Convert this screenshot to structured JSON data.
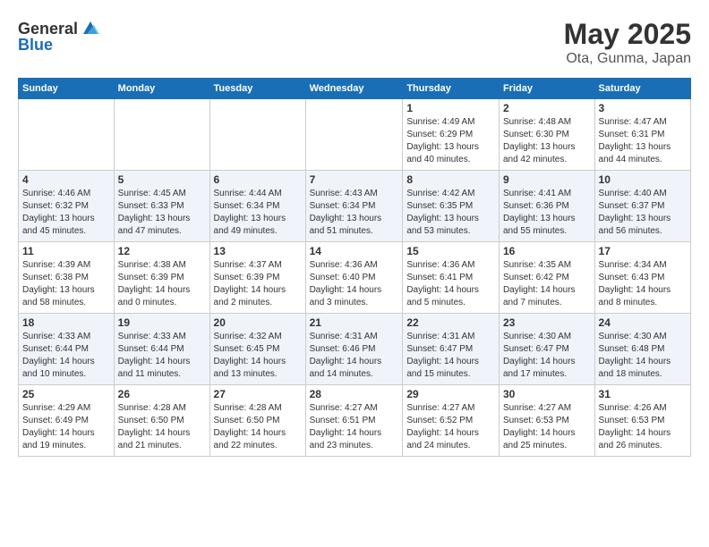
{
  "header": {
    "logo_general": "General",
    "logo_blue": "Blue",
    "month": "May 2025",
    "location": "Ota, Gunma, Japan"
  },
  "weekdays": [
    "Sunday",
    "Monday",
    "Tuesday",
    "Wednesday",
    "Thursday",
    "Friday",
    "Saturday"
  ],
  "weeks": [
    [
      {
        "day": "",
        "info": ""
      },
      {
        "day": "",
        "info": ""
      },
      {
        "day": "",
        "info": ""
      },
      {
        "day": "",
        "info": ""
      },
      {
        "day": "1",
        "info": "Sunrise: 4:49 AM\nSunset: 6:29 PM\nDaylight: 13 hours\nand 40 minutes."
      },
      {
        "day": "2",
        "info": "Sunrise: 4:48 AM\nSunset: 6:30 PM\nDaylight: 13 hours\nand 42 minutes."
      },
      {
        "day": "3",
        "info": "Sunrise: 4:47 AM\nSunset: 6:31 PM\nDaylight: 13 hours\nand 44 minutes."
      }
    ],
    [
      {
        "day": "4",
        "info": "Sunrise: 4:46 AM\nSunset: 6:32 PM\nDaylight: 13 hours\nand 45 minutes."
      },
      {
        "day": "5",
        "info": "Sunrise: 4:45 AM\nSunset: 6:33 PM\nDaylight: 13 hours\nand 47 minutes."
      },
      {
        "day": "6",
        "info": "Sunrise: 4:44 AM\nSunset: 6:34 PM\nDaylight: 13 hours\nand 49 minutes."
      },
      {
        "day": "7",
        "info": "Sunrise: 4:43 AM\nSunset: 6:34 PM\nDaylight: 13 hours\nand 51 minutes."
      },
      {
        "day": "8",
        "info": "Sunrise: 4:42 AM\nSunset: 6:35 PM\nDaylight: 13 hours\nand 53 minutes."
      },
      {
        "day": "9",
        "info": "Sunrise: 4:41 AM\nSunset: 6:36 PM\nDaylight: 13 hours\nand 55 minutes."
      },
      {
        "day": "10",
        "info": "Sunrise: 4:40 AM\nSunset: 6:37 PM\nDaylight: 13 hours\nand 56 minutes."
      }
    ],
    [
      {
        "day": "11",
        "info": "Sunrise: 4:39 AM\nSunset: 6:38 PM\nDaylight: 13 hours\nand 58 minutes."
      },
      {
        "day": "12",
        "info": "Sunrise: 4:38 AM\nSunset: 6:39 PM\nDaylight: 14 hours\nand 0 minutes."
      },
      {
        "day": "13",
        "info": "Sunrise: 4:37 AM\nSunset: 6:39 PM\nDaylight: 14 hours\nand 2 minutes."
      },
      {
        "day": "14",
        "info": "Sunrise: 4:36 AM\nSunset: 6:40 PM\nDaylight: 14 hours\nand 3 minutes."
      },
      {
        "day": "15",
        "info": "Sunrise: 4:36 AM\nSunset: 6:41 PM\nDaylight: 14 hours\nand 5 minutes."
      },
      {
        "day": "16",
        "info": "Sunrise: 4:35 AM\nSunset: 6:42 PM\nDaylight: 14 hours\nand 7 minutes."
      },
      {
        "day": "17",
        "info": "Sunrise: 4:34 AM\nSunset: 6:43 PM\nDaylight: 14 hours\nand 8 minutes."
      }
    ],
    [
      {
        "day": "18",
        "info": "Sunrise: 4:33 AM\nSunset: 6:44 PM\nDaylight: 14 hours\nand 10 minutes."
      },
      {
        "day": "19",
        "info": "Sunrise: 4:33 AM\nSunset: 6:44 PM\nDaylight: 14 hours\nand 11 minutes."
      },
      {
        "day": "20",
        "info": "Sunrise: 4:32 AM\nSunset: 6:45 PM\nDaylight: 14 hours\nand 13 minutes."
      },
      {
        "day": "21",
        "info": "Sunrise: 4:31 AM\nSunset: 6:46 PM\nDaylight: 14 hours\nand 14 minutes."
      },
      {
        "day": "22",
        "info": "Sunrise: 4:31 AM\nSunset: 6:47 PM\nDaylight: 14 hours\nand 15 minutes."
      },
      {
        "day": "23",
        "info": "Sunrise: 4:30 AM\nSunset: 6:47 PM\nDaylight: 14 hours\nand 17 minutes."
      },
      {
        "day": "24",
        "info": "Sunrise: 4:30 AM\nSunset: 6:48 PM\nDaylight: 14 hours\nand 18 minutes."
      }
    ],
    [
      {
        "day": "25",
        "info": "Sunrise: 4:29 AM\nSunset: 6:49 PM\nDaylight: 14 hours\nand 19 minutes."
      },
      {
        "day": "26",
        "info": "Sunrise: 4:28 AM\nSunset: 6:50 PM\nDaylight: 14 hours\nand 21 minutes."
      },
      {
        "day": "27",
        "info": "Sunrise: 4:28 AM\nSunset: 6:50 PM\nDaylight: 14 hours\nand 22 minutes."
      },
      {
        "day": "28",
        "info": "Sunrise: 4:27 AM\nSunset: 6:51 PM\nDaylight: 14 hours\nand 23 minutes."
      },
      {
        "day": "29",
        "info": "Sunrise: 4:27 AM\nSunset: 6:52 PM\nDaylight: 14 hours\nand 24 minutes."
      },
      {
        "day": "30",
        "info": "Sunrise: 4:27 AM\nSunset: 6:53 PM\nDaylight: 14 hours\nand 25 minutes."
      },
      {
        "day": "31",
        "info": "Sunrise: 4:26 AM\nSunset: 6:53 PM\nDaylight: 14 hours\nand 26 minutes."
      }
    ]
  ]
}
